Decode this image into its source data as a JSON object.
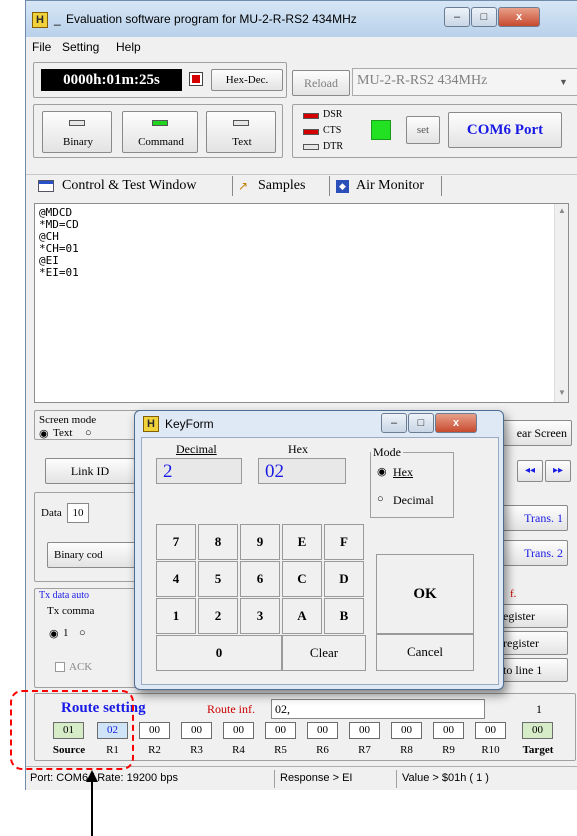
{
  "window": {
    "title": "Evaluation software program for MU-2-R-RS2  434MHz",
    "title_prefix": "_",
    "minimize": "–",
    "maximize": "□",
    "close": "x"
  },
  "menu": [
    "File",
    "Setting",
    "Help"
  ],
  "toolbar": {
    "timer": "0000h:01m:25s",
    "hexdec_label": "Hex-Dec.",
    "reload_label": "Reload",
    "device_value": "MU-2-R-RS2  434MHz"
  },
  "modes": [
    "Binary",
    "Command",
    "Text"
  ],
  "signals": {
    "dsr": "DSR",
    "cts": "CTS",
    "dtr": "DTR"
  },
  "port": {
    "set_label": "set",
    "com_label": "COM6 Port"
  },
  "tabs": [
    "Control  & Test Window",
    "Samples",
    "Air Monitor"
  ],
  "terminal": {
    "lines": [
      "@MDCD",
      "*MD=CD",
      "@CH",
      "*CH=01",
      "@EI",
      "*EI=01"
    ]
  },
  "left_panel": {
    "screen_mode": "Screen mode",
    "text_option": "Text",
    "link_id": "Link ID",
    "data_label": "Data",
    "data_value": "10",
    "binary_code": "Binary cod",
    "tx_auto": "Tx data auto",
    "tx_command": "Tx comma",
    "radio_1": "1",
    "ack": "ACK"
  },
  "right_panel": {
    "clear_screen": "ear Screen",
    "nav_prev": "◂◂",
    "nav_next": "▸▸",
    "trans1": "Trans. 1",
    "trans2": "Trans. 2",
    "inf": "f.",
    "register1": "egister",
    "register2": "register",
    "to_line": "to line 1"
  },
  "route": {
    "title": "Route setting",
    "info_label": "Route inf.",
    "info_value": "02,",
    "target_index": "1",
    "source_value": "01",
    "source_label": "Source",
    "target_value": "00",
    "target_label": "Target",
    "repeaters": [
      {
        "label": "R1",
        "value": "02"
      },
      {
        "label": "R2",
        "value": "00"
      },
      {
        "label": "R3",
        "value": "00"
      },
      {
        "label": "R4",
        "value": "00"
      },
      {
        "label": "R5",
        "value": "00"
      },
      {
        "label": "R6",
        "value": "00"
      },
      {
        "label": "R7",
        "value": "00"
      },
      {
        "label": "R8",
        "value": "00"
      },
      {
        "label": "R9",
        "value": "00"
      },
      {
        "label": "R10",
        "value": "00"
      }
    ]
  },
  "status": {
    "port": "Port: COM6 / Rate: 19200 bps",
    "response": "Response > EI",
    "value": "Value > $01h ( 1 )"
  },
  "keyform": {
    "title": "KeyForm",
    "decimal_label": "Decimal",
    "decimal_value": "2",
    "hex_label": "Hex",
    "hex_value": "02",
    "mode_label": "Mode",
    "mode_hex": "Hex",
    "mode_decimal": "Decimal",
    "keys": [
      [
        "7",
        "8",
        "9",
        "E",
        "F"
      ],
      [
        "4",
        "5",
        "6",
        "C",
        "D"
      ],
      [
        "1",
        "2",
        "3",
        "A",
        "B"
      ]
    ],
    "zero": "0",
    "clear": "Clear",
    "ok": "OK",
    "cancel": "Cancel"
  },
  "colors": {
    "timer_bg": "#000000",
    "timer_fg": "#ffffff",
    "com_blue": "#1a1ae6",
    "route_red": "#cc0000",
    "led_green": "#22d422",
    "led_red": "#d40000",
    "highlight": "#cfe4f7",
    "source_bg": "#d6ecc8",
    "annotation": "#ff0000"
  }
}
